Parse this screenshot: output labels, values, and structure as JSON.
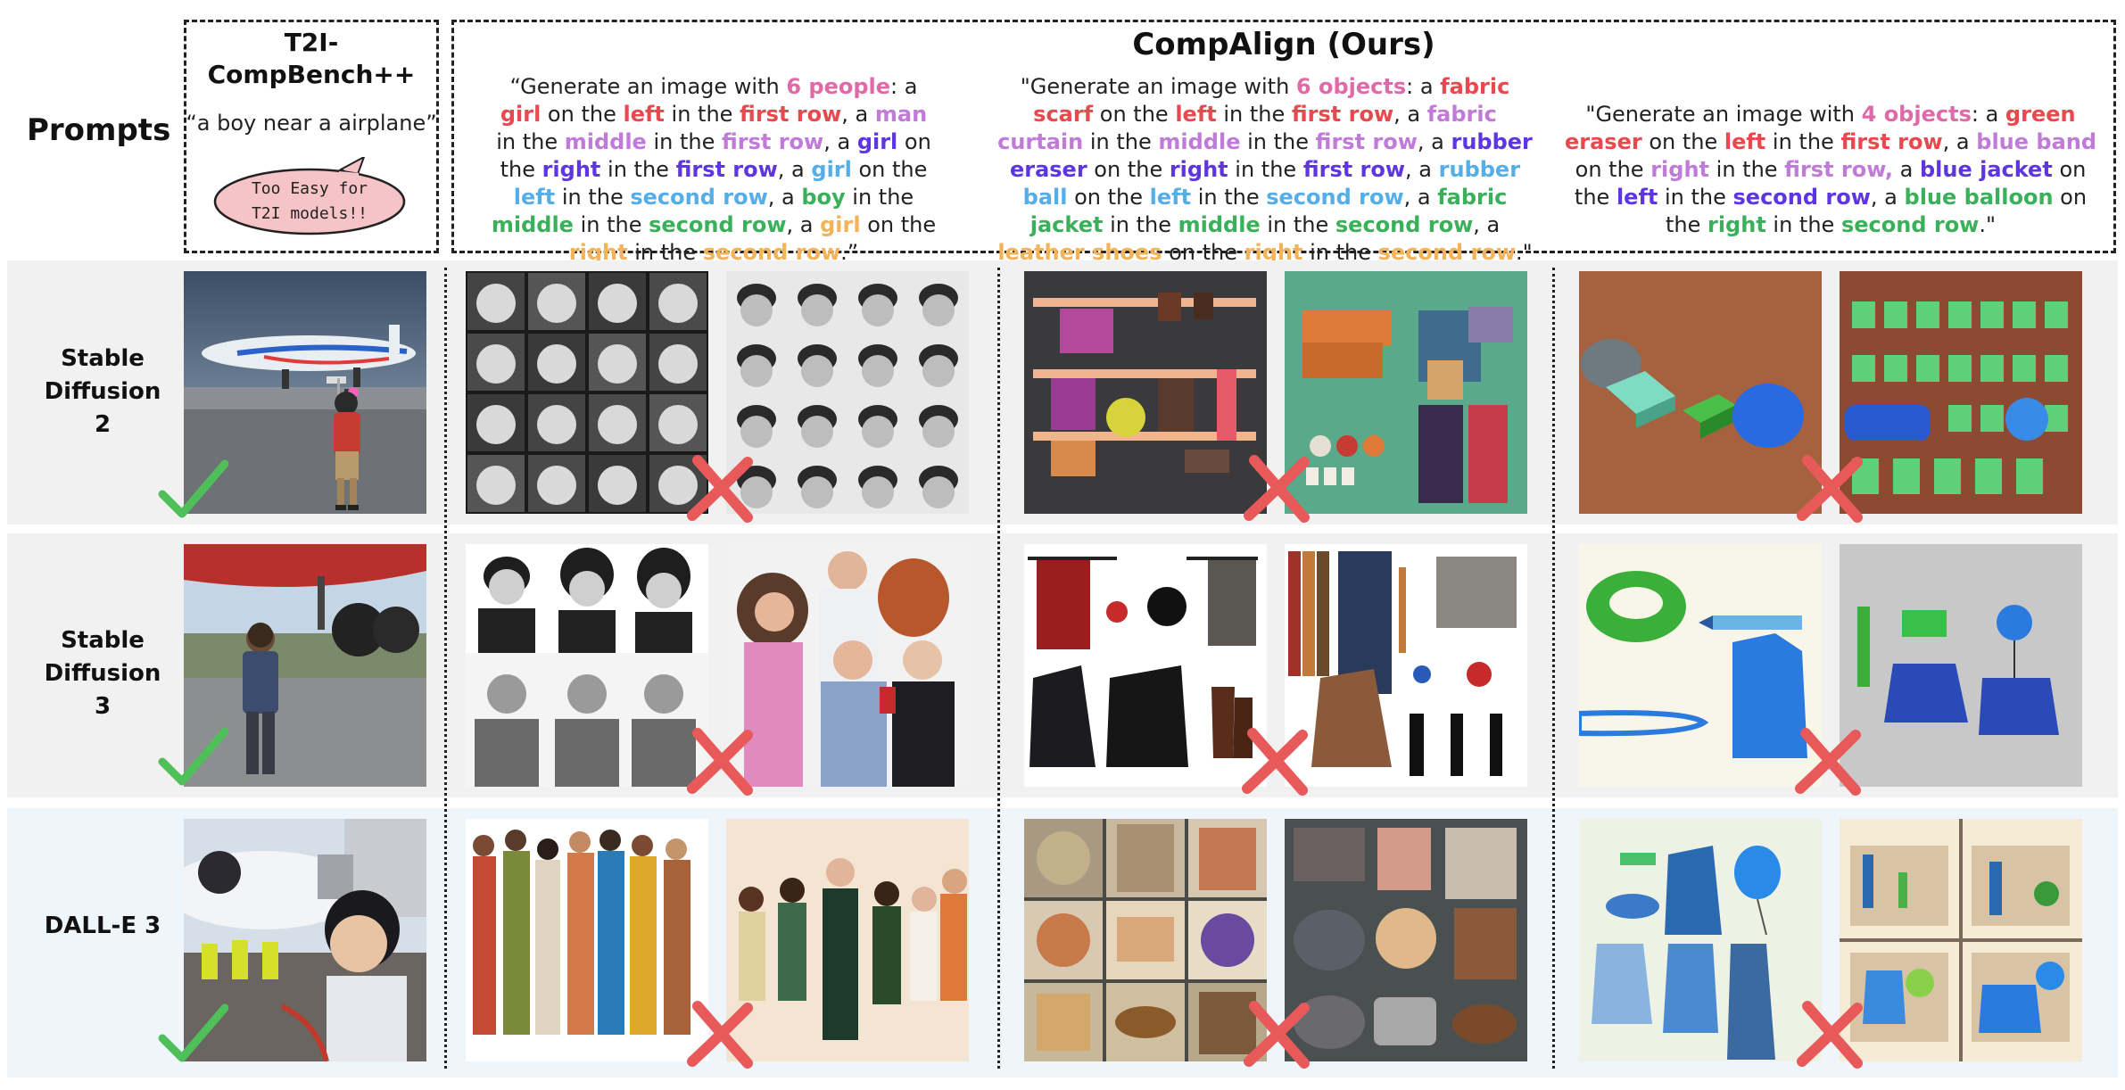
{
  "header": {
    "prompts_label": "Prompts",
    "t2i_title_line1": "T2I-",
    "t2i_title_line2": "CompBench++",
    "t2i_prompt": "“a boy near a airplane”",
    "bubble_line1": "Too Easy for",
    "bubble_line2": "T2I models!!",
    "compalign_title": "CompAlign (Ours)"
  },
  "prompts": {
    "people": [
      {
        "t": "“Generate an image with ",
        "c": ""
      },
      {
        "t": "6 people",
        "c": "c-pink"
      },
      {
        "t": ": a ",
        "c": ""
      },
      {
        "t": "girl",
        "c": "c-red"
      },
      {
        "t": " on the ",
        "c": ""
      },
      {
        "t": "left",
        "c": "c-red"
      },
      {
        "t": " in the ",
        "c": ""
      },
      {
        "t": "first row",
        "c": "c-red"
      },
      {
        "t": ", a ",
        "c": ""
      },
      {
        "t": "man",
        "c": "c-lav"
      },
      {
        "t": " in the ",
        "c": ""
      },
      {
        "t": "middle",
        "c": "c-lav"
      },
      {
        "t": " in the ",
        "c": ""
      },
      {
        "t": "first row",
        "c": "c-lav"
      },
      {
        "t": ", a ",
        "c": ""
      },
      {
        "t": "girl",
        "c": "c-purple"
      },
      {
        "t": " on the ",
        "c": ""
      },
      {
        "t": "right",
        "c": "c-purple"
      },
      {
        "t": " in the ",
        "c": ""
      },
      {
        "t": "first row",
        "c": "c-purple"
      },
      {
        "t": ", a ",
        "c": ""
      },
      {
        "t": "girl",
        "c": "c-sky"
      },
      {
        "t": " on the ",
        "c": ""
      },
      {
        "t": "left",
        "c": "c-sky"
      },
      {
        "t": " in the ",
        "c": ""
      },
      {
        "t": "second row",
        "c": "c-sky"
      },
      {
        "t": ", a ",
        "c": ""
      },
      {
        "t": "boy",
        "c": "c-green"
      },
      {
        "t": " in the ",
        "c": ""
      },
      {
        "t": "middle",
        "c": "c-green"
      },
      {
        "t": " in the ",
        "c": ""
      },
      {
        "t": "second row",
        "c": "c-green"
      },
      {
        "t": ", a ",
        "c": ""
      },
      {
        "t": "girl",
        "c": "c-orange"
      },
      {
        "t": " on the ",
        "c": ""
      },
      {
        "t": "right",
        "c": "c-orange"
      },
      {
        "t": " in the ",
        "c": ""
      },
      {
        "t": "second row",
        "c": "c-orange"
      },
      {
        "t": ".”",
        "c": ""
      }
    ],
    "objects6": [
      {
        "t": "\"Generate an image with ",
        "c": ""
      },
      {
        "t": "6 objects",
        "c": "c-pink"
      },
      {
        "t": ": a ",
        "c": ""
      },
      {
        "t": "fabric scarf",
        "c": "c-red"
      },
      {
        "t": " on the ",
        "c": ""
      },
      {
        "t": "left",
        "c": "c-red"
      },
      {
        "t": " in the ",
        "c": ""
      },
      {
        "t": "first row",
        "c": "c-red"
      },
      {
        "t": ", a ",
        "c": ""
      },
      {
        "t": "fabric curtain",
        "c": "c-lav"
      },
      {
        "t": " in the ",
        "c": ""
      },
      {
        "t": "middle",
        "c": "c-lav"
      },
      {
        "t": " in the ",
        "c": ""
      },
      {
        "t": "first row",
        "c": "c-lav"
      },
      {
        "t": ", a ",
        "c": ""
      },
      {
        "t": "rubber eraser",
        "c": "c-purple"
      },
      {
        "t": " on the ",
        "c": ""
      },
      {
        "t": "right",
        "c": "c-purple"
      },
      {
        "t": " in the ",
        "c": ""
      },
      {
        "t": "first row",
        "c": "c-purple"
      },
      {
        "t": ", a ",
        "c": ""
      },
      {
        "t": "rubber ball",
        "c": "c-sky"
      },
      {
        "t": " on the ",
        "c": ""
      },
      {
        "t": "left",
        "c": "c-sky"
      },
      {
        "t": " in the ",
        "c": ""
      },
      {
        "t": "second row",
        "c": "c-sky"
      },
      {
        "t": ", a ",
        "c": ""
      },
      {
        "t": "fabric jacket",
        "c": "c-green"
      },
      {
        "t": " in the ",
        "c": ""
      },
      {
        "t": "middle",
        "c": "c-green"
      },
      {
        "t": " in the ",
        "c": ""
      },
      {
        "t": "second row",
        "c": "c-green"
      },
      {
        "t": ", a ",
        "c": ""
      },
      {
        "t": "leather shoes",
        "c": "c-orange"
      },
      {
        "t": " on the ",
        "c": ""
      },
      {
        "t": "right",
        "c": "c-orange"
      },
      {
        "t": " in the ",
        "c": ""
      },
      {
        "t": "second row",
        "c": "c-orange"
      },
      {
        "t": ".\"",
        "c": ""
      }
    ],
    "objects4": [
      {
        "t": "\"Generate an image with ",
        "c": ""
      },
      {
        "t": "4 objects",
        "c": "c-pink"
      },
      {
        "t": ": a ",
        "c": ""
      },
      {
        "t": "green eraser",
        "c": "c-red"
      },
      {
        "t": " on the ",
        "c": ""
      },
      {
        "t": "left",
        "c": "c-red"
      },
      {
        "t": " in the ",
        "c": ""
      },
      {
        "t": "first row",
        "c": "c-red"
      },
      {
        "t": ", a ",
        "c": ""
      },
      {
        "t": "blue band",
        "c": "c-lav"
      },
      {
        "t": " on the ",
        "c": ""
      },
      {
        "t": "right",
        "c": "c-lav"
      },
      {
        "t": " in the ",
        "c": ""
      },
      {
        "t": "first row,",
        "c": "c-lav"
      },
      {
        "t": " a ",
        "c": ""
      },
      {
        "t": "blue jacket",
        "c": "c-purple"
      },
      {
        "t": " on the ",
        "c": ""
      },
      {
        "t": "left",
        "c": "c-purple"
      },
      {
        "t": " in the ",
        "c": ""
      },
      {
        "t": "second row",
        "c": "c-purple"
      },
      {
        "t": ", a ",
        "c": ""
      },
      {
        "t": "blue balloon",
        "c": "c-green"
      },
      {
        "t": " on the ",
        "c": ""
      },
      {
        "t": "right",
        "c": "c-green"
      },
      {
        "t": " in the ",
        "c": ""
      },
      {
        "t": "second row",
        "c": "c-green"
      },
      {
        "t": ".\"",
        "c": ""
      }
    ]
  },
  "rows": {
    "sd2": {
      "line1": "Stable",
      "line2": "Diffusion",
      "line3": "2"
    },
    "sd3": {
      "line1": "Stable",
      "line2": "Diffusion 3"
    },
    "dalle": {
      "line1": "DALL-E 3"
    }
  },
  "colors": {
    "band_gray": "#f1f1f1",
    "band_blue": "#eef6fc",
    "check_green": "#4fbf5a",
    "cross_red": "#e85a5a"
  }
}
